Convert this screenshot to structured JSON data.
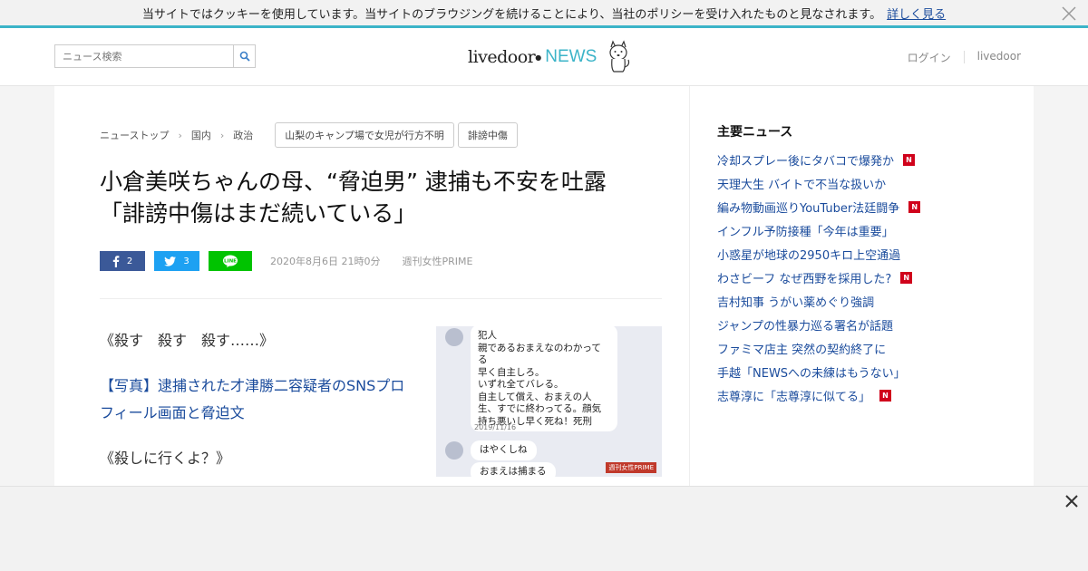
{
  "cookie": {
    "message": "当サイトではクッキーを使用しています。当サイトのブラウジングを続けることにより、当社のポリシーを受け入れたものと見なされます。",
    "more_label": "詳しく見る"
  },
  "header": {
    "search_placeholder": "ニュース検索",
    "logo_text": "livedoor",
    "logo_news": "NEWS",
    "login_label": "ログイン",
    "livedoor_label": "livedoor"
  },
  "breadcrumbs": [
    "ニューストップ",
    "国内",
    "政治"
  ],
  "tags": [
    "山梨のキャンプ場で女児が行方不明",
    "誹謗中傷"
  ],
  "article": {
    "title_line1": "小倉美咲ちゃんの母、“脅迫男” 逮捕も不安を吐露",
    "title_line2": "「誹謗中傷はまだ続いている」",
    "date": "2020年8月6日 21時0分",
    "source": "週刊女性PRIME",
    "p1": "《殺す　殺す　殺す……》",
    "link": "【写真】逮捕された才津勝二容疑者のSNSプロフィール画面と脅迫文",
    "p2": "《殺しに行くよ？》"
  },
  "share": {
    "facebook_count": "2",
    "twitter_count": "3"
  },
  "photo": {
    "bubble1": [
      "犯人",
      "親であるおまえなのわかってる",
      "早く自主しろ。",
      "いずれ全てバレる。",
      "自主して償え、おまえの人生、すでに終わってる。顔気持ち悪いし早く死ね！死刑"
    ],
    "timestamp": "2019/11/16",
    "bubble2": "はやくしね",
    "bubble3": "おまえは捕まる",
    "watermark": "週刊女性PRIME"
  },
  "sidebar": {
    "heading": "主要ニュース",
    "items": [
      {
        "label": "冷却スプレー後にタバコで爆発か",
        "badge": "N"
      },
      {
        "label": "天理大生 バイトで不当な扱いか",
        "badge": ""
      },
      {
        "label": "編み物動画巡りYouTuber法廷闘争",
        "badge": "N"
      },
      {
        "label": "インフル予防接種「今年は重要」",
        "badge": ""
      },
      {
        "label": "小惑星が地球の2950キロ上空通過",
        "badge": ""
      },
      {
        "label": "わさビーフ なぜ西野を採用した?",
        "badge": "N"
      },
      {
        "label": "吉村知事 うがい薬めぐり強調",
        "badge": ""
      },
      {
        "label": "ジャンプの性暴力巡る署名が話題",
        "badge": ""
      },
      {
        "label": "ファミマ店主 突然の契約終了に",
        "badge": ""
      },
      {
        "label": "手越「NEWSへの未練はもうない」",
        "badge": ""
      },
      {
        "label": "志尊淳に「志尊淳に似てる」",
        "badge": "N"
      }
    ]
  },
  "colors": {
    "accent": "#3cb4c8",
    "link": "#1a4b9c",
    "badge": "#d0021b",
    "facebook": "#3b5998",
    "twitter": "#1da1f2",
    "line": "#00c300"
  }
}
